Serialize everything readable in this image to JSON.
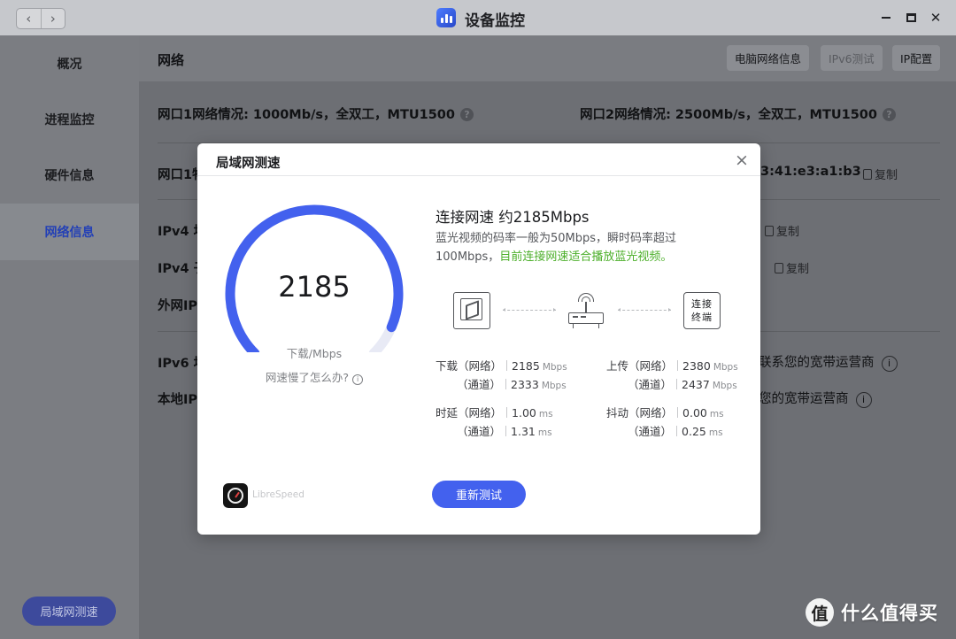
{
  "window": {
    "title": "设备监控",
    "colors": {
      "accent": "#4361ee",
      "success": "#4caf2a"
    }
  },
  "sidebar": {
    "items": [
      {
        "label": "概况"
      },
      {
        "label": "进程监控"
      },
      {
        "label": "硬件信息"
      },
      {
        "label": "网络信息"
      }
    ],
    "active_index": 3,
    "speed_button": "局域网测速"
  },
  "main": {
    "title": "网络",
    "header_buttons": [
      {
        "label": "电脑网络信息",
        "enabled": true
      },
      {
        "label": "IPv6测试",
        "enabled": false
      },
      {
        "label": "IP配置",
        "enabled": true
      }
    ],
    "port1_status": "网口1网络情况: 1000Mb/s，全双工，MTU1500",
    "port2_status": "网口2网络情况: 2500Mb/s，全双工，MTU1500",
    "rows": [
      {
        "label": "网口1物",
        "tail": "3:41:e3:a1:b3",
        "action": "复制"
      },
      {
        "label": "IPv4 地",
        "tail": "",
        "action": "复制"
      },
      {
        "label": "IPv4 子",
        "tail": "",
        "action": "复制"
      },
      {
        "label": "外网IP",
        "tail": "",
        "action": ""
      },
      {
        "label": "IPv6 地",
        "tail": "联系您的宽带运营商",
        "action": ""
      },
      {
        "label": "本地IP",
        "tail": "您的宽带运营商",
        "action": ""
      }
    ]
  },
  "modal": {
    "title": "局域网测速",
    "gauge": {
      "value": "2185",
      "unit": "下载/Mbps",
      "help": "网速慢了怎么办?",
      "fill_fraction": 0.92
    },
    "connection_title": "连接网速 约2185Mbps",
    "description": "蓝光视频的码率一般为50Mbps，瞬时码率超过100Mbps，",
    "description_highlight": "目前连接网速适合播放蓝光视频。",
    "terminal_label": "连接终端",
    "stats": {
      "download_label": "下载（网络）",
      "channel_label": "（通道）",
      "download_net": "2185",
      "download_chan": "2333",
      "upload_label": "上传（网络）",
      "upload_net": "2380",
      "upload_chan": "2437",
      "latency_label": "时延（网络）",
      "latency_net": "1.00",
      "latency_chan": "1.31",
      "jitter_label": "抖动（网络）",
      "jitter_net": "0.00",
      "jitter_chan": "0.25",
      "unit_speed": "Mbps",
      "unit_time": "ms"
    },
    "powered_by": "LibreSpeed",
    "retest_button": "重新测试"
  },
  "watermark": {
    "text": "什么值得买",
    "logo_glyph": "值"
  }
}
